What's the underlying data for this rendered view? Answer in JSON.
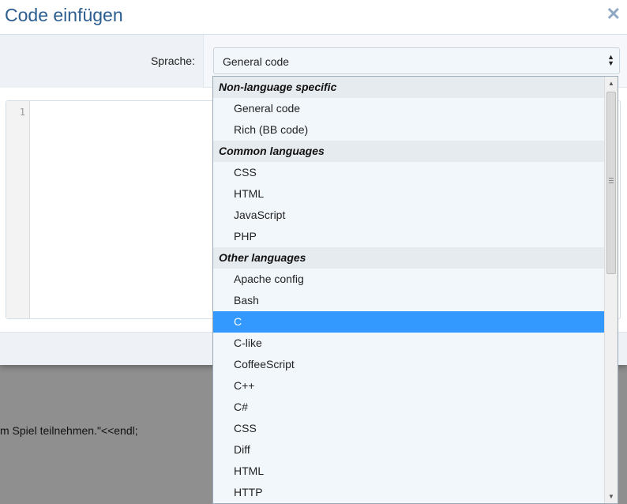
{
  "background": {
    "text": "m Spiel teilnehmen.\"<<endl;"
  },
  "dialog": {
    "title": "Code einfügen",
    "close_glyph": "✕",
    "language_label": "Sprache:",
    "language_selected": "General code"
  },
  "editor": {
    "line_number": "1"
  },
  "dropdown": {
    "items": [
      {
        "type": "group",
        "label": "Non-language specific"
      },
      {
        "type": "option",
        "label": "General code"
      },
      {
        "type": "option",
        "label": "Rich (BB code)"
      },
      {
        "type": "group",
        "label": "Common languages"
      },
      {
        "type": "option",
        "label": "CSS"
      },
      {
        "type": "option",
        "label": "HTML"
      },
      {
        "type": "option",
        "label": "JavaScript"
      },
      {
        "type": "option",
        "label": "PHP"
      },
      {
        "type": "group",
        "label": "Other languages"
      },
      {
        "type": "option",
        "label": "Apache config"
      },
      {
        "type": "option",
        "label": "Bash"
      },
      {
        "type": "option",
        "label": "C",
        "selected": true
      },
      {
        "type": "option",
        "label": "C-like"
      },
      {
        "type": "option",
        "label": "CoffeeScript"
      },
      {
        "type": "option",
        "label": "C++"
      },
      {
        "type": "option",
        "label": "C#"
      },
      {
        "type": "option",
        "label": "CSS"
      },
      {
        "type": "option",
        "label": "Diff"
      },
      {
        "type": "option",
        "label": "HTML"
      },
      {
        "type": "option",
        "label": "HTTP"
      }
    ]
  },
  "colors": {
    "accent": "#2b5d8f",
    "selection": "#3399ff",
    "dropdown_bg": "#f2f7fc"
  },
  "icons": {
    "close": "close-icon",
    "select_arrows": "sort-arrows-icon",
    "scroll_up": "scroll-up-arrow-icon",
    "scroll_down": "scroll-down-arrow-icon"
  }
}
